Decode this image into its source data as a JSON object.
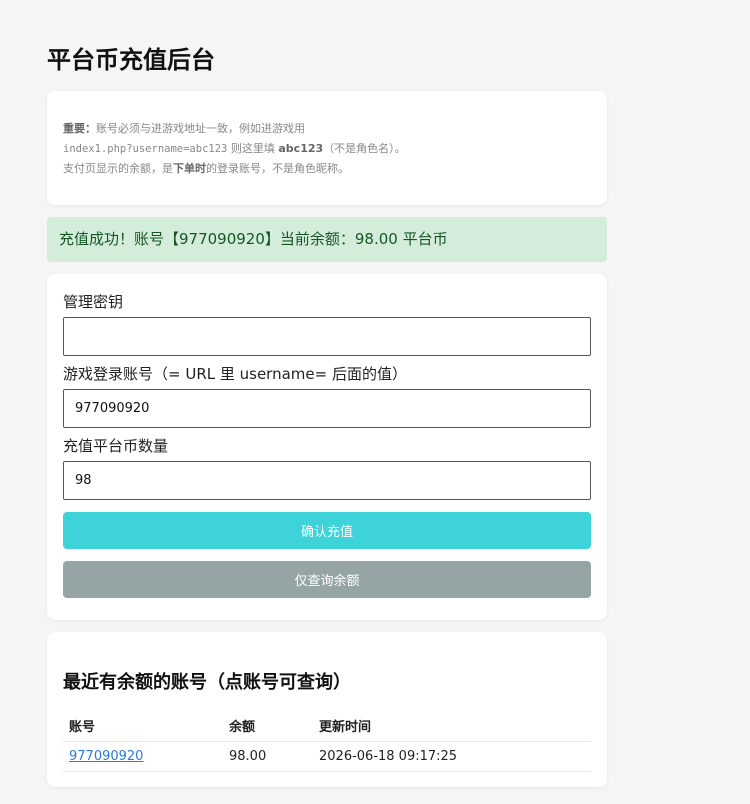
{
  "page": {
    "title": "平台币充值后台"
  },
  "notice": {
    "important_label": "重要：",
    "line1_text": "账号必须与进游戏地址一致，例如进游戏用",
    "example_url": "index1.php?username=abc123",
    "line2_mid": " 则这里填 ",
    "example_user": "abc123",
    "line2_end": "（不是角色名）。",
    "line3_start": "支付页显示的余额，是",
    "line3_bold": "下单时",
    "line3_end": "的登录账号，不是角色昵称。"
  },
  "success": {
    "message": "充值成功！账号【977090920】当前余额：98.00 平台币"
  },
  "form": {
    "secret_label": "管理密钥",
    "secret_value": "",
    "account_label": "游戏登录账号（= URL 里 username= 后面的值）",
    "account_value": "977090920",
    "amount_label": "充值平台币数量",
    "amount_value": "98",
    "confirm_label": "确认充值",
    "query_label": "仅查询余额"
  },
  "recent": {
    "title": "最近有余额的账号（点账号可查询）",
    "columns": [
      "账号",
      "余额",
      "更新时间"
    ],
    "rows": [
      {
        "account": "977090920",
        "balance": "98.00",
        "updated": "2026-06-18 09:17:25"
      }
    ]
  },
  "colors": {
    "primary": "#3dd3d8",
    "secondary": "#95a5a6",
    "success_bg": "#d4edda",
    "success_text": "#155724",
    "link": "#2a7ad6"
  }
}
